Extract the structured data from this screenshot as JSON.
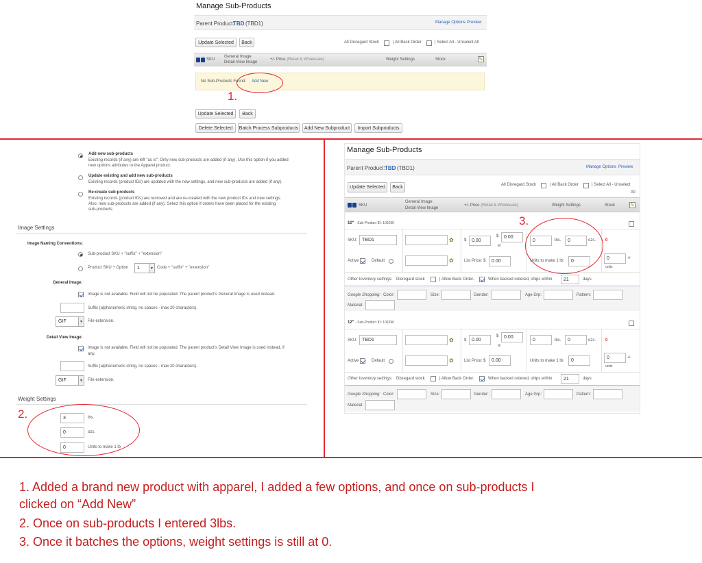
{
  "top": {
    "title": "Manage Sub-Products",
    "parent_label": "Parent Product:",
    "parent_code": "TBD",
    "parent_id": "(TBD1)",
    "manage_options": "Manage Options",
    "preview": "Preview",
    "update_selected": "Update Selected",
    "back": "Back",
    "all_disregard": "All Disregard Stock",
    "all_back_order": "| All Back Order",
    "select_all": "| Select All - Unselect All",
    "col_sku": "SKU",
    "col_image": "General Image",
    "col_detail": "Detail View Image",
    "col_price": "+/- Price",
    "col_price_note": "(Retail & Wholesale)",
    "col_weight": "Weight Settings",
    "col_stock": "Stock",
    "no_products": "No Sub-Products Found.",
    "add_new": "Add New",
    "delete_selected": "Delete Selected",
    "batch_process": "Batch Process Subproducts",
    "add_new_sub": "Add New Subproduct",
    "import_sub": "Import Subproducts"
  },
  "left": {
    "opt1_title": "Add new sub-products",
    "opt1_desc1": "Existing records (if any) are left \"as is\". Only new sub-products are added (if any). Use this option if you added",
    "opt1_desc2": "new options attributes to the Apparel product.",
    "opt2_title": "Update existing and add new sub-products",
    "opt2_desc": "Existing records (product IDs) are updated with the new settings, and new sub-products are added (if any).",
    "opt3_title": "Re-create sub-products",
    "opt3_desc1": "Existing records (product IDs) are removed and are re-created with the new product IDs and new settings.",
    "opt3_desc2": "Also, new sub-products are added (if any). Select this option if orders have been placed for the existing",
    "opt3_desc3": "sub-products.",
    "image_settings": "Image Settings",
    "naming": "Image Naming Conventions:",
    "naming_opt1": "Sub-product SKU + \"suffix\" + \"extension\"",
    "naming_opt2a": "Product SKU + Option",
    "naming_opt2_val": "1",
    "naming_opt2b": "Code + \"suffix\" + \"extension\"",
    "general_image": "General Image:",
    "gen_note": "Image is not available. Field will not be populated. The parent product's General Image is used instead.",
    "suffix_note": "Suffix (alphanumeric string, no spaces - max 20 characters).",
    "ext_val": "GIF",
    "ext_note": "File extension.",
    "detail_image": "Detail View Image:",
    "det_note1": "Image is not available. Field will not be populated. The parent product's Detail View Image is used instead, if",
    "det_note2": "any.",
    "weight_settings": "Weight Settings",
    "lbs_val": "3",
    "lbs": "lbs.",
    "ozs_val": "0",
    "ozs": "ozs.",
    "units_val": "0",
    "units": "Units to make 1 lb"
  },
  "right": {
    "title": "Manage Sub-Products",
    "parent_label": "Parent Product:",
    "parent_code": "TBD",
    "parent_id": "(TBD1)",
    "manage_options": "Manage Options",
    "preview": "Preview",
    "update_selected": "Update Selected",
    "back": "Back",
    "all_disregard": "All Disregard Stock",
    "all_back_order": "| All Back Order",
    "select_all": "| Select All - Unselect",
    "select_all2": "All",
    "col_sku": "SKU",
    "col_image": "General Image",
    "col_detail": "Detail View Image",
    "col_price": "+/- Price",
    "col_price_note": "(Retail & Wholesale)",
    "col_weight": "Weight Settings",
    "col_stock": "Stock",
    "items": [
      {
        "name": "10\"",
        "id_label": "- Sub-Product ID: 106295",
        "sku": "TBD1",
        "price": "0.00",
        "price2": "0.00",
        "lbs": "0",
        "ozs": "0",
        "units": "0",
        "stock": "0",
        "list_price": "0.00",
        "ships": "21"
      },
      {
        "name": "12\"",
        "id_label": "- Sub-Product ID: 106296",
        "sku": "TBD1",
        "price": "0.00",
        "price2": "0.00",
        "lbs": "0",
        "ozs": "0",
        "units": "0",
        "stock": "0",
        "list_price": "0.00",
        "ships": "21"
      }
    ],
    "sku_label": "SKU:",
    "active": "Active",
    "default": "Default",
    "list_price_label": "List Price: $",
    "units_label": "Units to make 1 lb:",
    "lbs": "lbs.",
    "ozs": "ozs.",
    "dollar": "$",
    "w": "w",
    "plusminus": "+/-",
    "units_word": "units",
    "other_inv": "Other Inventory settings:",
    "disregard": "Disregard stock",
    "allow_back": "| Allow Back Order.",
    "when_back": "When backed ordered, ships within",
    "days": "days.",
    "google": "Google Shopping:",
    "color": "Color:",
    "size": "Size:",
    "gender": "Gender:",
    "age": "Age Grp:",
    "pattern": "Pattern:",
    "material": "Material:"
  },
  "annotations": {
    "n1": "1.",
    "n2": "2.",
    "n3": "3.",
    "note1a": "1. Added a brand new product with apparel, I added a few options, and once on sub-products I",
    "note1b": "clicked on “Add New”",
    "note2": "2. Once on sub-products I entered 3lbs.",
    "note3": "3. Once it batches the options, weight settings is still at 0."
  },
  "colors": {
    "annotation": "#e3262d",
    "link": "#2a62b8",
    "notice": "#fbf6dc"
  }
}
